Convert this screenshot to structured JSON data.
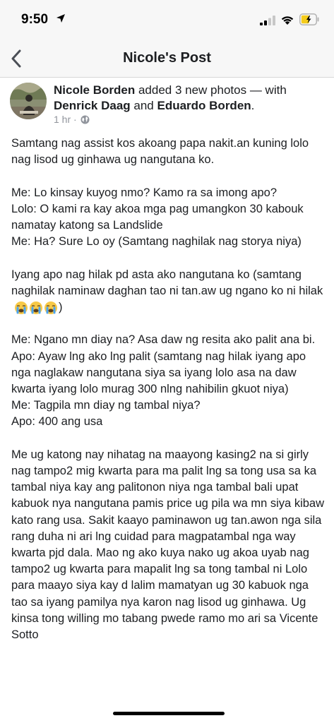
{
  "status_bar": {
    "time": "9:50"
  },
  "nav": {
    "title": "Nicole's Post"
  },
  "post": {
    "author": "Nicole Borden",
    "action": " added 3 new photos — with ",
    "tag1": "Denrick Daag",
    "and": " and ",
    "tag2": "Eduardo Borden",
    "period": ".",
    "time": "1 hr ·",
    "paragraphs": [
      "Samtang nag assist kos akoang papa nakit.an kuning lolo nag lisod ug ginhawa ug nangutana ko.",
      "Me: Lo kinsay kuyog nmo? Kamo ra sa imong apo?\nLolo: O kami ra kay akoa mga pag umangkon 30 kabouk namatay katong sa Landslide\nMe: Ha? Sure Lo oy (Samtang naghilak nag storya niya)",
      "Iyang apo nag hilak pd asta ako nangutana ko (samtang naghilak naminaw daghan tao ni tan.aw ug ngano ko ni hilak",
      "Me: Ngano mn diay na? Asa daw ng resita ako palit ana bi.\nApo: Ayaw lng ako lng palit (samtang nag hilak iyang apo nga naglakaw nangutana siya sa iyang lolo asa na daw kwarta iyang lolo murag 300 nlng nahibilin gkuot niya)\nMe: Tagpila mn diay ng tambal niya?\nApo: 400 ang usa",
      "Me ug katong nay nihatag na maayong kasing2 na si girly nag tampo2 mig kwarta para ma palit lng sa tong usa sa ka tambal niya kay ang palitonon niya nga tambal bali upat kabuok nya nangutana pamis price ug pila wa mn siya kibaw kato rang usa. Sakit kaayo paminawon ug tan.awon nga sila rang duha ni ari lng cuidad para magpatambal nga way kwarta pjd dala. Mao ng ako kuya nako ug akoa uyab nag tampo2 ug kwarta para mapalit lng sa tong tambal ni Lolo para maayo siya kay d lalim mamatyan ug 30 kabuok nga tao sa iyang pamilya nya karon nag lisod ug ginhawa. Ug kinsa tong willing mo tabang pwede ramo mo ari sa Vicente Sotto"
    ],
    "para3_close": ")"
  },
  "icons": {
    "back": "chevron-left-icon",
    "location": "location-arrow-icon",
    "signal": "cellular-signal-icon",
    "wifi": "wifi-icon",
    "battery": "battery-icon",
    "globe": "globe-icon",
    "emoji": "loudly-crying-face-emoji"
  },
  "colors": {
    "link_text": "#1c1e21",
    "meta": "#90949c",
    "battery_fill": "#f5cc1b"
  }
}
